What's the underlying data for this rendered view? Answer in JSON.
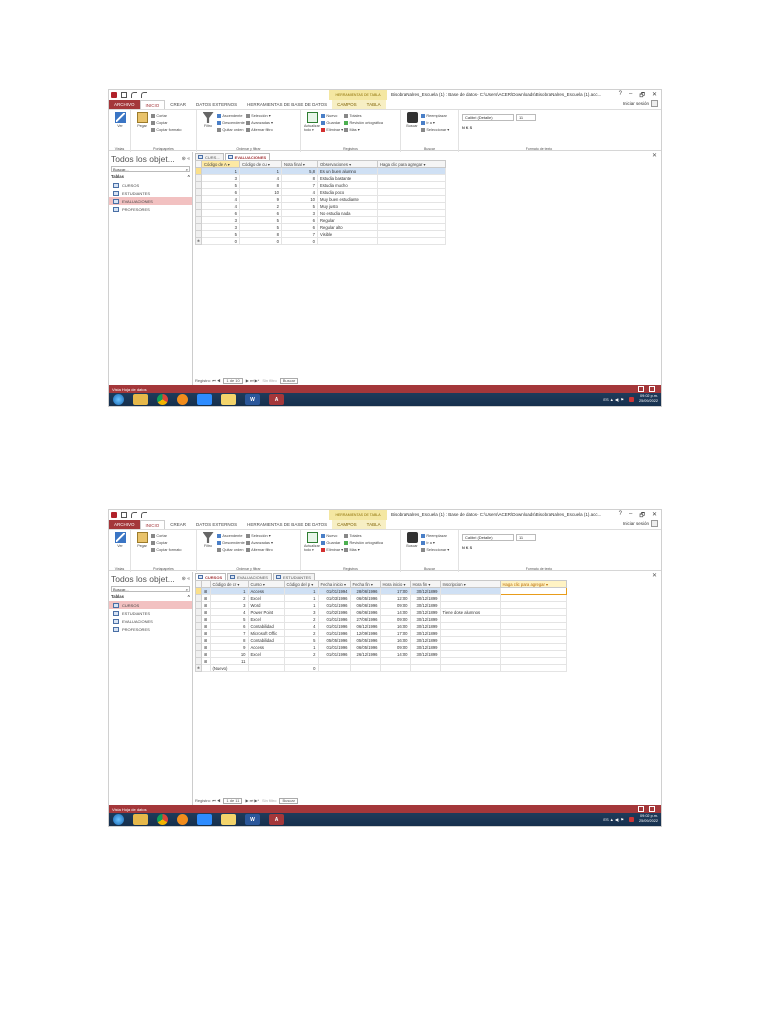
{
  "app": {
    "context_header": "HERRAMIENTAS DE TABLA",
    "window_title": "BisobraNalres_Escuela (1) : Base de datos- C:\\Users\\ACER\\Downloads\\BisobraNalres_Escuela (1).acc...",
    "window_buttons": [
      "?",
      "–",
      "🗗",
      "✕"
    ],
    "user": "Iniciar sesión",
    "tabs": [
      "ARCHIVO",
      "INICIO",
      "CREAR",
      "DATOS EXTERNOS",
      "HERRAMIENTAS DE BASE DE DATOS",
      "CAMPOS",
      "TABLA"
    ]
  },
  "ribbon": {
    "view": "Ver",
    "paste": "Pegar",
    "cut": "Cortar",
    "copy": "Copiar",
    "format_painter": "Copiar formato",
    "filter": "Filtro",
    "ascending": "Ascendente",
    "descending": "Descendente",
    "remove_sort": "Quitar orden",
    "selection": "Selección ▾",
    "advanced": "Avanzadas ▾",
    "toggle_filter": "Alternar filtro",
    "refresh": "Actualizar todo ▾",
    "new": "Nuevo",
    "save": "Guardar",
    "delete": "Eliminar ▾",
    "totals": "Totales",
    "spelling": "Revisión ortográfica",
    "more": "Más ▾",
    "find": "Buscar",
    "replace": "Reemplazar",
    "goto": "Ir a ▾",
    "select": "Seleccionar ▾",
    "font_name": "Calibri (Detalle)",
    "font_size": "11",
    "font_buttons": "N  K  S",
    "group_views": "Vistas",
    "group_clipboard": "Portapapeles",
    "group_sort": "Ordenar y filtrar",
    "group_records": "Registros",
    "group_find": "Buscar",
    "group_text": "Formato de texto"
  },
  "nav": {
    "title": "Todos los objet...",
    "search_placeholder": "Buscar...",
    "section": "Tablas",
    "items": [
      "CURSOS",
      "ESTUDIANTES",
      "EVALUACIONES",
      "PROFESORES"
    ]
  },
  "status": {
    "text": "Vista Hoja de datos"
  },
  "taskbar": {
    "word": "W",
    "access": "A",
    "tray_text": "ES  ▲  ◀)  ⚑",
    "clock_time": "09:02 p.m.",
    "clock_date": "25/09/2022"
  },
  "shot1": {
    "doc_tabs": [
      "CURS...",
      "EVALUACIONES"
    ],
    "headers": [
      "Código de A ▾",
      "Código de cu ▾",
      "Nota final ▾",
      "Observaciones ▾",
      "Haga clic para agregar ▾"
    ],
    "rows": [
      [
        "1",
        "1",
        "5,8",
        "Es un buen alumno"
      ],
      [
        "3",
        "4",
        "8",
        "Estudia bastante"
      ],
      [
        "5",
        "8",
        "7",
        "Estudia mucho"
      ],
      [
        "6",
        "10",
        "4",
        "Estudia poco"
      ],
      [
        "4",
        "9",
        "10",
        "Muy buen estudiante"
      ],
      [
        "4",
        "2",
        "5",
        "Muy justo"
      ],
      [
        "6",
        "6",
        "3",
        "No estudia nada"
      ],
      [
        "3",
        "5",
        "6",
        "Regular"
      ],
      [
        "3",
        "5",
        "6",
        "Regular alto"
      ],
      [
        "5",
        "8",
        "7",
        "Visible"
      ]
    ],
    "new_row": [
      "0",
      "0",
      "0",
      ""
    ],
    "record_nav": {
      "label": "Registro: ⏮ ◀",
      "position": "1 de 10",
      "next": "▶ ⏭ ▶*",
      "nofilter": "Sin filtro",
      "search": "Buscar"
    }
  },
  "shot2": {
    "doc_tabs": [
      "CURSOS",
      "EVALUACIONES",
      "ESTUDIANTES"
    ],
    "headers": [
      "Código de cr ▾",
      "Curso ▾",
      "Código del p ▾",
      "Fecha inicio ▾",
      "Fecha fin ▾",
      "Hora inicio ▾",
      "Hora fin ▾",
      "Inscripcion ▾",
      "Haga clic para agregar ▾"
    ],
    "rows": [
      [
        "1",
        "Access",
        "1",
        "01/01/1994",
        "28/06/1996",
        "17:00",
        "30/12/1899",
        ""
      ],
      [
        "2",
        "Excel",
        "1",
        "01/03/1996",
        "06/05/1996",
        "12:00",
        "30/12/1899",
        ""
      ],
      [
        "3",
        "Word",
        "1",
        "01/01/1996",
        "06/06/1996",
        "09:00",
        "30/12/1899",
        ""
      ],
      [
        "4",
        "Power Point",
        "3",
        "01/02/1996",
        "06/06/1996",
        "14:00",
        "30/12/1899",
        "Tiene dose alumnos"
      ],
      [
        "5",
        "Excel",
        "2",
        "01/01/1996",
        "27/06/1996",
        "09:00",
        "30/12/1899",
        ""
      ],
      [
        "6",
        "Contabilidad",
        "4",
        "01/01/1996",
        "06/12/1996",
        "16:00",
        "30/12/1899",
        ""
      ],
      [
        "7",
        "Microsoft Offic",
        "2",
        "01/01/1996",
        "12/09/1996",
        "17:00",
        "30/12/1899",
        ""
      ],
      [
        "8",
        "Contabilidad",
        "5",
        "05/05/1996",
        "05/05/1996",
        "16:00",
        "30/12/1899",
        ""
      ],
      [
        "9",
        "Access",
        "1",
        "01/01/1996",
        "06/05/1996",
        "09:00",
        "30/12/1899",
        ""
      ],
      [
        "10",
        "Excel",
        "2",
        "01/01/1996",
        "26/12/1996",
        "14:00",
        "30/12/1899",
        ""
      ],
      [
        "11",
        "",
        "",
        "",
        "",
        "",
        "",
        ""
      ]
    ],
    "new_row": [
      "(Nuevo)",
      "",
      "0",
      "",
      "",
      "",
      "",
      ""
    ],
    "record_nav": {
      "label": "Registro: ⏮ ◀",
      "position": "1 de 11",
      "next": "▶ ⏭ ▶*",
      "nofilter": "Sin filtro",
      "search": "Buscar"
    }
  }
}
